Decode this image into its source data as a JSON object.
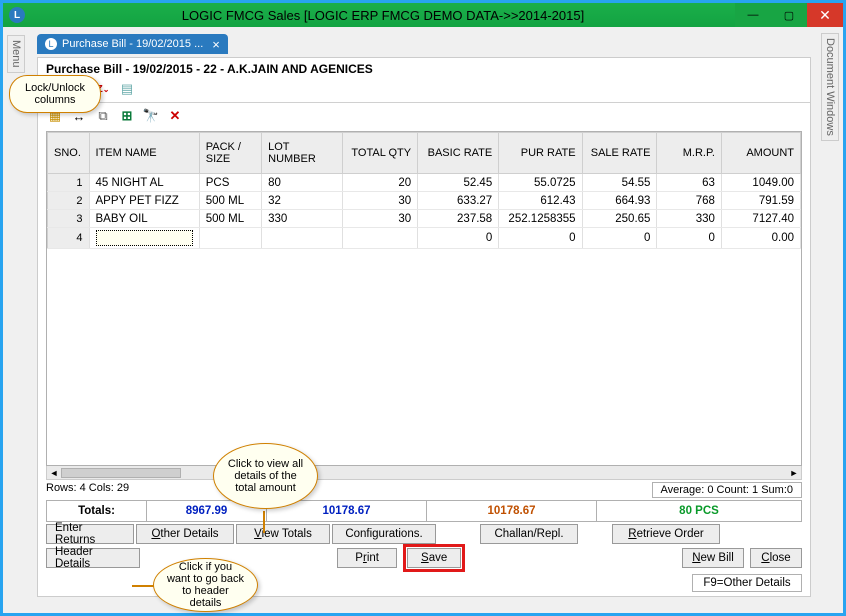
{
  "window": {
    "title": "LOGIC FMCG Sales  [LOGIC ERP FMCG DEMO DATA->>2014-2015]"
  },
  "side_tabs": {
    "left": "Menu",
    "right": "Document Windows"
  },
  "doc_tab": {
    "label": "Purchase Bill - 19/02/2015 ..."
  },
  "panel": {
    "title": "Purchase Bill - 19/02/2015 - 22 - A.K.JAIN AND AGENICES"
  },
  "columns": {
    "sno": "SNO.",
    "item": "ITEM NAME",
    "pack": "PACK / SIZE",
    "lot": "LOT NUMBER",
    "qty": "TOTAL QTY",
    "basic": "BASIC RATE",
    "pur": "PUR RATE",
    "sale": "SALE RATE",
    "mrp": "M.R.P.",
    "amount": "AMOUNT"
  },
  "rows": [
    {
      "sno": "1",
      "item": "45 NIGHT AL",
      "pack": "PCS",
      "lot": "80",
      "qty": "20",
      "basic": "52.45",
      "pur": "55.0725",
      "sale": "54.55",
      "mrp": "63",
      "amount": "1049.00"
    },
    {
      "sno": "2",
      "item": "APPY PET FIZZ",
      "pack": "500 ML",
      "lot": "32",
      "qty": "30",
      "basic": "633.27",
      "pur": "612.43",
      "sale": "664.93",
      "mrp": "768",
      "amount": "791.59"
    },
    {
      "sno": "3",
      "item": "BABY OIL",
      "pack": "500 ML",
      "lot": "330",
      "qty": "30",
      "basic": "237.58",
      "pur": "252.1258355",
      "sale": "250.65",
      "mrp": "330",
      "amount": "7127.40"
    },
    {
      "sno": "4",
      "item": "",
      "pack": "",
      "lot": "",
      "qty": "",
      "basic": "0",
      "pur": "0",
      "sale": "0",
      "mrp": "0",
      "amount": "0.00"
    }
  ],
  "grid_footer": {
    "left": "Rows: 4  Cols: 29",
    "right": "Average: 0  Count: 1  Sum:0"
  },
  "totals": {
    "label": "Totals:",
    "v1": "8967.99",
    "v2": "10178.67",
    "v3": "10178.67",
    "v4": "80 PCS"
  },
  "buttons": {
    "enter_returns": "Enter Returns",
    "other_details": "Other Details",
    "view_totals": "View Totals",
    "configurations": "Configurations.",
    "challan": "Challan/Repl.",
    "retrieve": "Retrieve Order",
    "header_details": "Header Details",
    "print": "Print",
    "save": "Save",
    "new_bill": "New Bill",
    "close": "Close"
  },
  "status": {
    "other_details": "F9=Other Details"
  },
  "callouts": {
    "lock": "Lock/Unlock columns",
    "view_totals": "Click to view all details of the total amount",
    "header_details": "Click if you want to go back to header details"
  }
}
